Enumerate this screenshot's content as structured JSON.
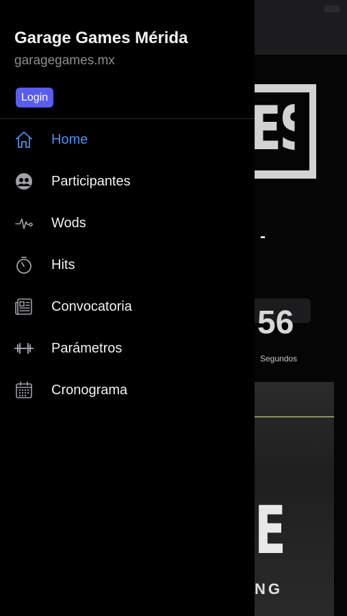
{
  "app": {
    "title": "Garage Games Mérida",
    "subtitle": "garagegames.mx",
    "login_label": "Login"
  },
  "menu": {
    "items": [
      {
        "label": "Home",
        "icon": "home-icon",
        "active": true
      },
      {
        "label": "Participantes",
        "icon": "participants-icon",
        "active": false
      },
      {
        "label": "Wods",
        "icon": "pulse-icon",
        "active": false
      },
      {
        "label": "Hits",
        "icon": "stopwatch-icon",
        "active": false
      },
      {
        "label": "Convocatoria",
        "icon": "newspaper-icon",
        "active": false
      },
      {
        "label": "Parámetros",
        "icon": "dumbbell-icon",
        "active": false
      },
      {
        "label": "Cronograma",
        "icon": "calendar-icon",
        "active": false
      }
    ]
  },
  "background": {
    "logo_text": "ES",
    "dash": "-",
    "countdown_value": "56",
    "countdown_unit": "Segundos",
    "image_letter": "E",
    "image_caption": "NG"
  },
  "colors": {
    "active": "#4a90f0",
    "inactive": "#f2f2f2",
    "icon_inactive": "#a0a0a8",
    "login_bg": "#5b5cf0",
    "subtitle": "#8e8e93"
  }
}
